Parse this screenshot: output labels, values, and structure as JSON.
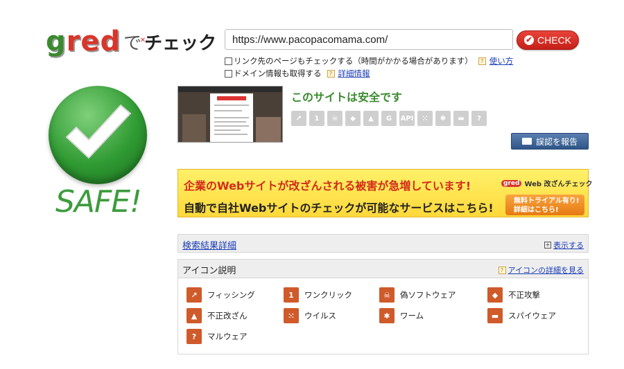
{
  "logo": {
    "g": "g",
    "r": "r",
    "e": "e",
    "d": "d",
    "de": "で",
    "check": "チェック"
  },
  "search": {
    "url_value": "https://www.pacopacomama.com/",
    "check_label": "CHECK",
    "option1_label": "リンク先のページもチェックする（時間がかかる場合があります）",
    "option1_help_link": "使い方",
    "option2_label": "ドメイン情報も取得する",
    "option2_help_link": "詳細情報"
  },
  "result": {
    "badge_text": "SAFE!",
    "status_text": "このサイトは安全です",
    "report_label": "誤認を報告",
    "status_icons": [
      "phishing-icon",
      "one-click-icon",
      "fake-software-icon",
      "attack-icon",
      "tamper-icon",
      "g-icon",
      "api-icon",
      "virus-icon",
      "worm-icon",
      "spyware-icon",
      "malware-icon"
    ],
    "icon_glyphs": [
      "↗",
      "1",
      "☠",
      "◆",
      "▲",
      "G",
      "API",
      "⁙",
      "✱",
      "▬",
      "?"
    ]
  },
  "banner": {
    "line1": "企業のWebサイトが改ざんされる被害が急増しています!",
    "line2": "自動で自社Webサイトのチェックが可能なサービスはこちら!",
    "brand_mini": "gred",
    "brand_text": "Web 改ざんチェック",
    "trial_line1": "無料トライアル有り!",
    "trial_line2": "詳細はこちら!"
  },
  "details": {
    "title": "検索結果詳細",
    "show_label": "表示する",
    "plus": "+"
  },
  "legend": {
    "title": "アイコン説明",
    "more_link": "アイコンの詳細を見る",
    "items": [
      {
        "label": "フィッシング",
        "glyph": "↗"
      },
      {
        "label": "ワンクリック",
        "glyph": "1"
      },
      {
        "label": "偽ソフトウェア",
        "glyph": "☠"
      },
      {
        "label": "不正攻撃",
        "glyph": "◆"
      },
      {
        "label": "不正改ざん",
        "glyph": "▲"
      },
      {
        "label": "ウイルス",
        "glyph": "⁙"
      },
      {
        "label": "ワーム",
        "glyph": "✱"
      },
      {
        "label": "スパイウェア",
        "glyph": "▬"
      },
      {
        "label": "マルウェア",
        "glyph": "?"
      }
    ]
  },
  "colors": {
    "safe_green": "#3a8a2e",
    "check_red": "#d52b22",
    "link_blue": "#1a3cb5",
    "icon_red": "#cf5a2a"
  }
}
